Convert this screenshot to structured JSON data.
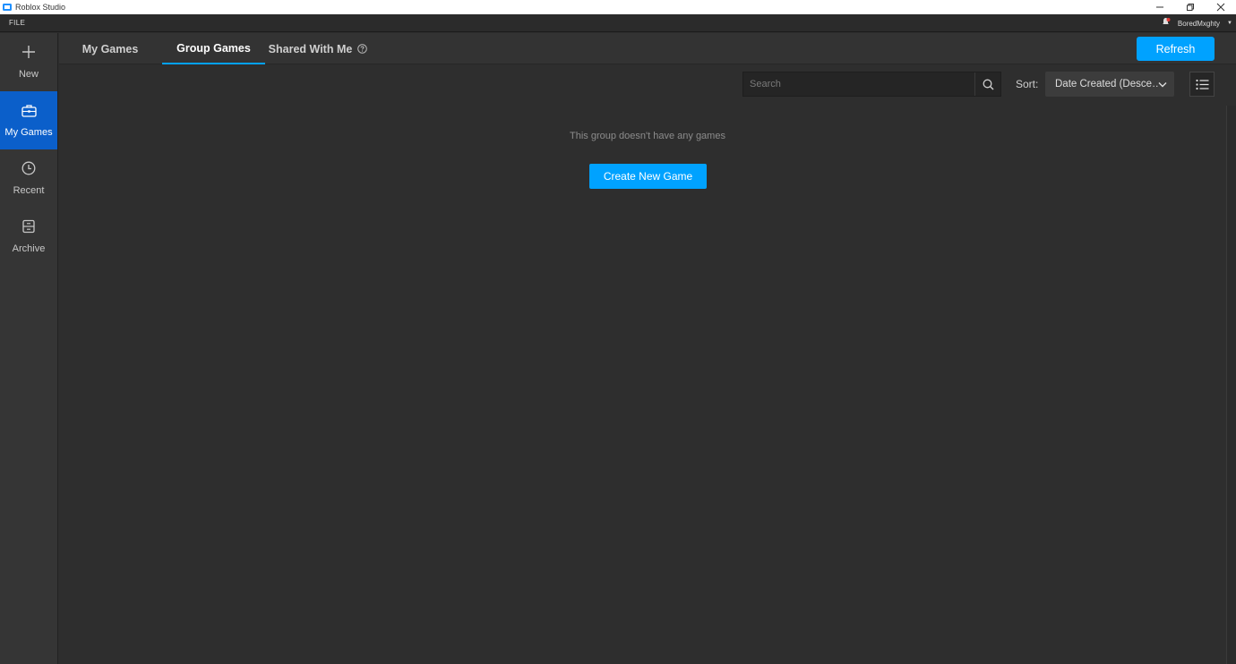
{
  "window": {
    "title": "Roblox Studio"
  },
  "menu": {
    "file": "FILE",
    "user": "BoredMxghty"
  },
  "sidebar": {
    "items": [
      {
        "label": "New",
        "icon": "plus-icon",
        "active": false
      },
      {
        "label": "My Games",
        "icon": "briefcase-icon",
        "active": true
      },
      {
        "label": "Recent",
        "icon": "clock-icon",
        "active": false
      },
      {
        "label": "Archive",
        "icon": "archive-icon",
        "active": false
      }
    ]
  },
  "tabs": [
    {
      "label": "My Games",
      "active": false
    },
    {
      "label": "Group Games",
      "active": true
    },
    {
      "label": "Shared With Me",
      "active": false
    }
  ],
  "toolbar": {
    "refresh_label": "Refresh",
    "search_placeholder": "Search",
    "sort_label": "Sort:",
    "sort_value": "Date Created (Desce…"
  },
  "content": {
    "empty_message": "This group doesn't have any games",
    "create_label": "Create New Game"
  },
  "colors": {
    "accent": "#00a2ff",
    "sidebar_active": "#0b5fca",
    "background": "#2e2e2e"
  }
}
